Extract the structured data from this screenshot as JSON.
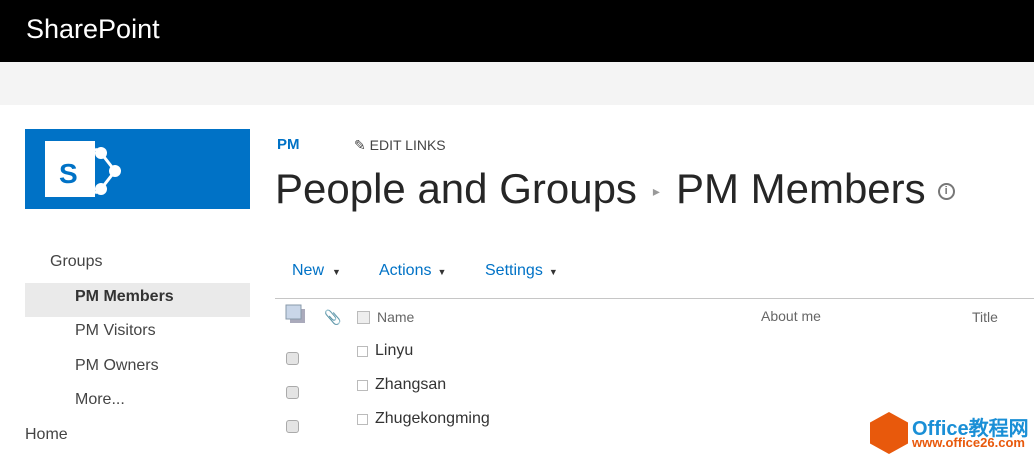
{
  "header": {
    "brand": "SharePoint"
  },
  "nav": {
    "heading": "Groups",
    "items": [
      "PM Members",
      "PM Visitors",
      "PM Owners",
      "More..."
    ],
    "home": "Home"
  },
  "breadcrumb": {
    "site": "PM",
    "edit_links": "EDIT LINKS"
  },
  "page": {
    "parent": "People and Groups",
    "title": "PM Members",
    "info": "i"
  },
  "toolbar": {
    "new": "New",
    "actions": "Actions",
    "settings": "Settings"
  },
  "table": {
    "columns": [
      "Name",
      "About me",
      "Title"
    ],
    "rows": [
      "Linyu",
      "Zhangsan",
      "Zhugekongming"
    ]
  },
  "watermark": {
    "line1": "Office教程网",
    "line2": "www.office26.com"
  }
}
